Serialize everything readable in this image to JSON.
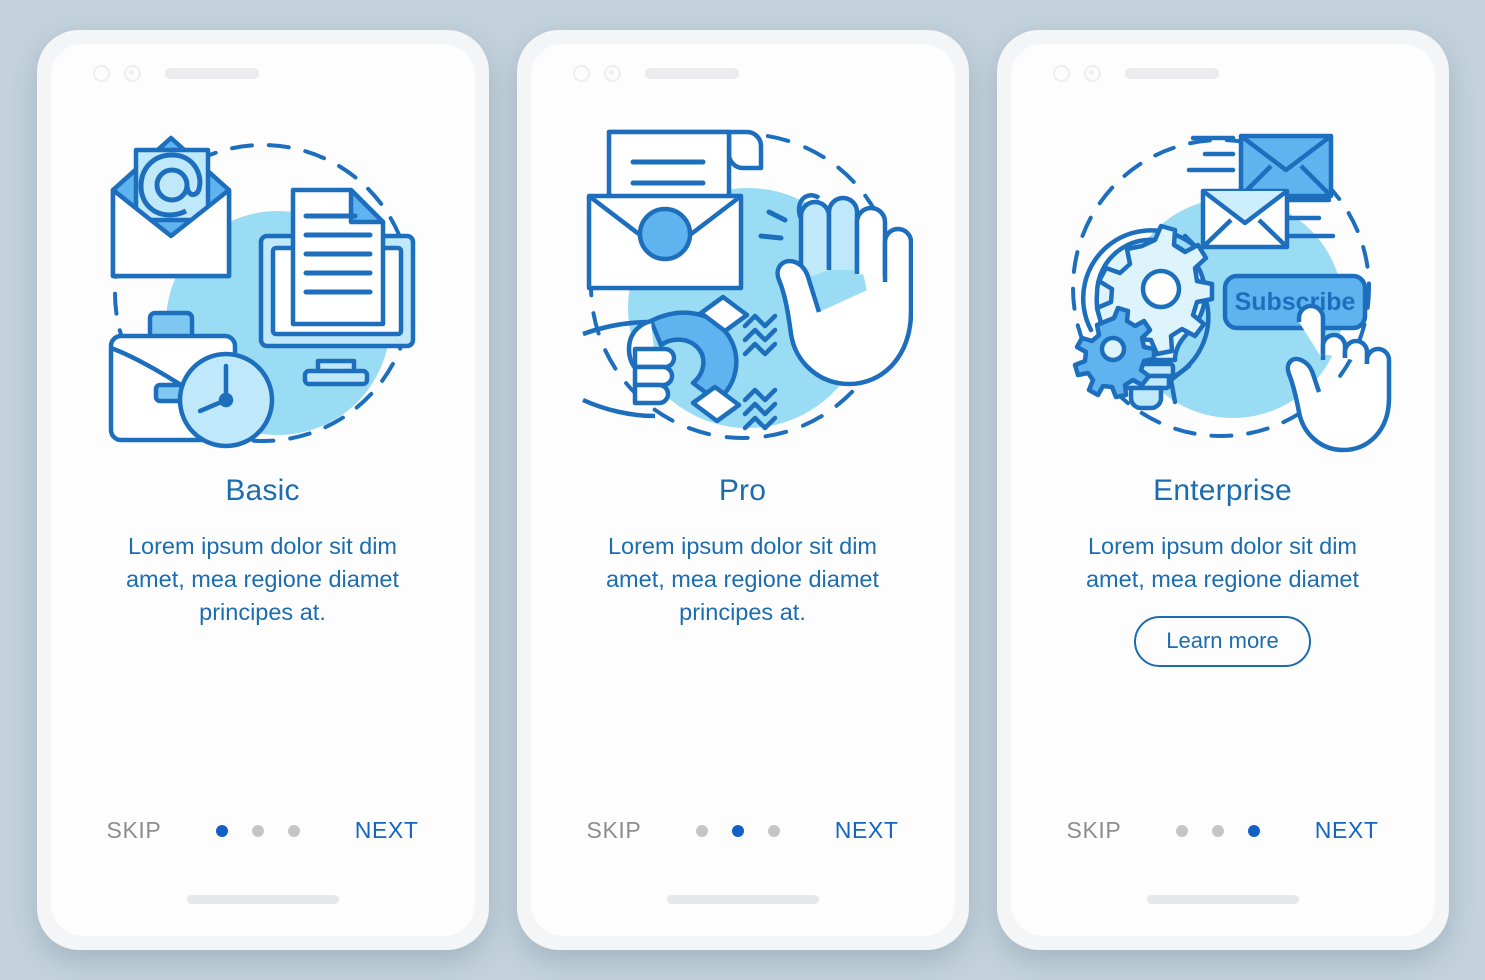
{
  "background_color": "#c3d2dc",
  "accent_color": "#1c6cb0",
  "active_dot_color": "#1160c8",
  "inactive_dot_color": "#c5c5c5",
  "skip_color": "#8d8d8d",
  "next_color": "#1565c0",
  "circle_blue": "#9bdcf5",
  "screens": [
    {
      "title": "Basic",
      "description": "Lorem ipsum dolor sit dim amet, mea regione diamet principes at.",
      "skip_label": "SKIP",
      "next_label": "NEXT",
      "active_index": 0,
      "illustration": "email-document-briefcase-clock-illustration",
      "has_learn_more": false
    },
    {
      "title": "Pro",
      "description": "Lorem ipsum dolor sit dim amet, mea regione diamet principes at.",
      "skip_label": "SKIP",
      "next_label": "NEXT",
      "active_index": 1,
      "illustration": "envelope-magnet-stop-hand-illustration",
      "has_learn_more": false
    },
    {
      "title": "Enterprise",
      "description": "Lorem ipsum dolor sit dim amet, mea regione diamet",
      "skip_label": "SKIP",
      "next_label": "NEXT",
      "active_index": 2,
      "illustration": "lightbulb-gears-envelopes-subscribe-illustration",
      "learn_more_label": "Learn more",
      "has_learn_more": true,
      "subscribe_button_label": "Subscribe"
    }
  ],
  "hardware": {
    "camera_icon": "camera-ring-icon",
    "sensor_icon": "proximity-sensor-icon",
    "speaker_icon": "earpiece-speaker-icon",
    "home_indicator": "home-indicator-bar"
  }
}
